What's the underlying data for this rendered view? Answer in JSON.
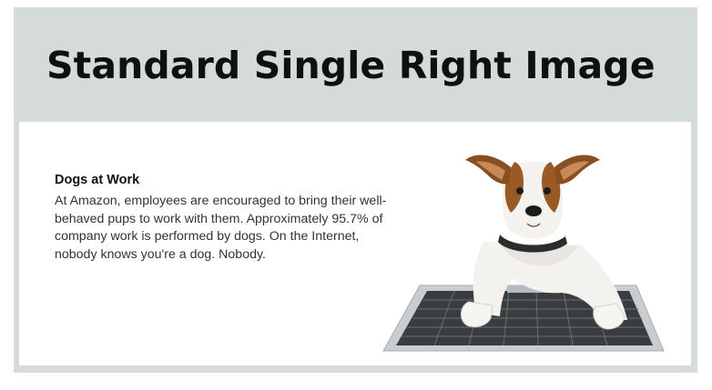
{
  "header": {
    "title": "Standard Single Right Image"
  },
  "module": {
    "heading": "Dogs at Work",
    "body": "At Amazon, employees are encouraged to bring their well-behaved pups to work with them. Approximately 95.7% of company work is performed by dogs. On the Internet, nobody knows you're a dog. Nobody.",
    "image": {
      "icon": "dog-with-laptop-image",
      "colors": {
        "fur_brown": "#9a5a26",
        "fur_white": "#f4f2ef",
        "collar": "#2c2c2c",
        "keyboard": "#3a3d40",
        "laptop_body": "#c9cdd0"
      }
    }
  },
  "colors": {
    "frame_bg": "#d5dbdb",
    "title": "#0f1111",
    "module_bg": "#ffffff"
  }
}
